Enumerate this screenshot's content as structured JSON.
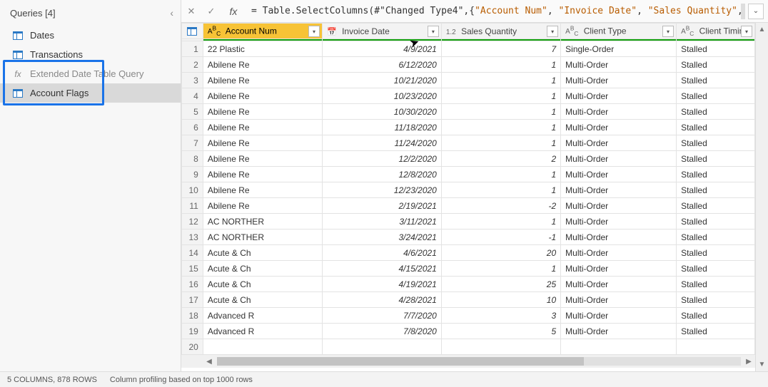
{
  "sidebar": {
    "title": "Queries [4]",
    "items": [
      {
        "label": "Dates",
        "icon": "table"
      },
      {
        "label": "Transactions",
        "icon": "table"
      },
      {
        "label": "Extended Date Table Query",
        "icon": "fx",
        "partial": true
      },
      {
        "label": "Account Flags",
        "icon": "table",
        "selected": true
      }
    ]
  },
  "formula": {
    "prefix": "= ",
    "fn": "Table.SelectColumns",
    "open": "(#",
    "ref": "\"Changed Type4\"",
    "sep": ",{",
    "args": [
      "\"Account Num\"",
      "\"Invoice Date\"",
      "\"Sales Quantity\""
    ],
    "trail": ","
  },
  "columns": [
    {
      "name": "Account Num",
      "type": "ABC",
      "selected": true,
      "align": "txt"
    },
    {
      "name": "Invoice Date",
      "type": "cal",
      "selected": false,
      "align": "num"
    },
    {
      "name": "Sales Quantity",
      "type": "1.2",
      "selected": false,
      "align": "num"
    },
    {
      "name": "Client Type",
      "type": "ABC",
      "selected": false,
      "align": "txt"
    },
    {
      "name": "Client Timing",
      "type": "ABC",
      "selected": false,
      "align": "txt"
    }
  ],
  "rows": [
    {
      "n": 1,
      "c": [
        "22 Plastic",
        "4/9/2021",
        "7",
        "Single-Order",
        "Stalled"
      ]
    },
    {
      "n": 2,
      "c": [
        "Abilene Re",
        "6/12/2020",
        "1",
        "Multi-Order",
        "Stalled"
      ]
    },
    {
      "n": 3,
      "c": [
        "Abilene Re",
        "10/21/2020",
        "1",
        "Multi-Order",
        "Stalled"
      ]
    },
    {
      "n": 4,
      "c": [
        "Abilene Re",
        "10/23/2020",
        "1",
        "Multi-Order",
        "Stalled"
      ]
    },
    {
      "n": 5,
      "c": [
        "Abilene Re",
        "10/30/2020",
        "1",
        "Multi-Order",
        "Stalled"
      ]
    },
    {
      "n": 6,
      "c": [
        "Abilene Re",
        "11/18/2020",
        "1",
        "Multi-Order",
        "Stalled"
      ]
    },
    {
      "n": 7,
      "c": [
        "Abilene Re",
        "11/24/2020",
        "1",
        "Multi-Order",
        "Stalled"
      ]
    },
    {
      "n": 8,
      "c": [
        "Abilene Re",
        "12/2/2020",
        "2",
        "Multi-Order",
        "Stalled"
      ]
    },
    {
      "n": 9,
      "c": [
        "Abilene Re",
        "12/8/2020",
        "1",
        "Multi-Order",
        "Stalled"
      ]
    },
    {
      "n": 10,
      "c": [
        "Abilene Re",
        "12/23/2020",
        "1",
        "Multi-Order",
        "Stalled"
      ]
    },
    {
      "n": 11,
      "c": [
        "Abilene Re",
        "2/19/2021",
        "-2",
        "Multi-Order",
        "Stalled"
      ]
    },
    {
      "n": 12,
      "c": [
        "AC NORTHER",
        "3/11/2021",
        "1",
        "Multi-Order",
        "Stalled"
      ]
    },
    {
      "n": 13,
      "c": [
        "AC NORTHER",
        "3/24/2021",
        "-1",
        "Multi-Order",
        "Stalled"
      ]
    },
    {
      "n": 14,
      "c": [
        "Acute & Ch",
        "4/6/2021",
        "20",
        "Multi-Order",
        "Stalled"
      ]
    },
    {
      "n": 15,
      "c": [
        "Acute & Ch",
        "4/15/2021",
        "1",
        "Multi-Order",
        "Stalled"
      ]
    },
    {
      "n": 16,
      "c": [
        "Acute & Ch",
        "4/19/2021",
        "25",
        "Multi-Order",
        "Stalled"
      ]
    },
    {
      "n": 17,
      "c": [
        "Acute & Ch",
        "4/28/2021",
        "10",
        "Multi-Order",
        "Stalled"
      ]
    },
    {
      "n": 18,
      "c": [
        "Advanced R",
        "7/7/2020",
        "3",
        "Multi-Order",
        "Stalled"
      ]
    },
    {
      "n": 19,
      "c": [
        "Advanced R",
        "7/8/2020",
        "5",
        "Multi-Order",
        "Stalled"
      ]
    },
    {
      "n": 20,
      "c": [
        "",
        "",
        "",
        "",
        ""
      ]
    }
  ],
  "status": {
    "cols_rows": "5 COLUMNS, 878 ROWS",
    "profiling": "Column profiling based on top 1000 rows"
  },
  "col_widths": [
    "30",
    "170",
    "170",
    "170",
    "165",
    "110"
  ]
}
